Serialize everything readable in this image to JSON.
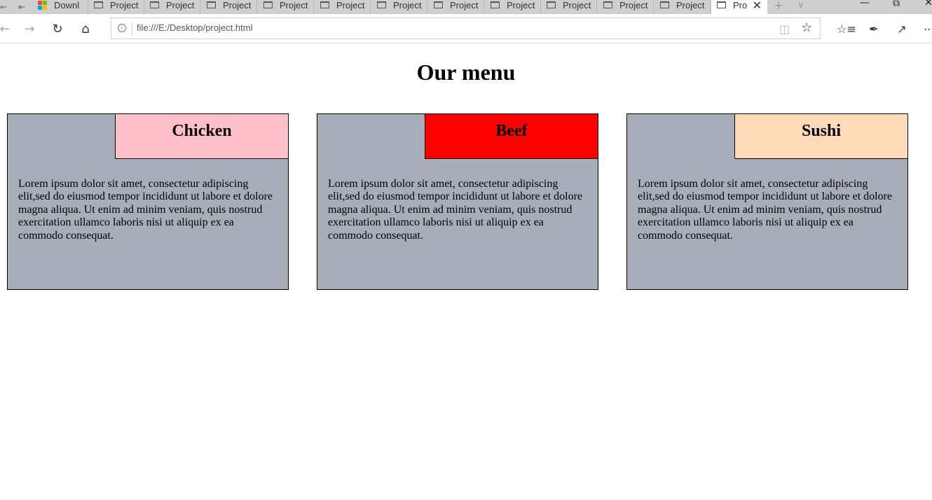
{
  "browser": {
    "tabs": [
      {
        "label": "Downl",
        "icon": "microsoft-icon"
      },
      {
        "label": "Project",
        "icon": "page-icon"
      },
      {
        "label": "Project",
        "icon": "page-icon"
      },
      {
        "label": "Project",
        "icon": "page-icon"
      },
      {
        "label": "Project",
        "icon": "page-icon"
      },
      {
        "label": "Project",
        "icon": "page-icon"
      },
      {
        "label": "Project",
        "icon": "page-icon"
      },
      {
        "label": "Project",
        "icon": "page-icon"
      },
      {
        "label": "Project",
        "icon": "page-icon"
      },
      {
        "label": "Project",
        "icon": "page-icon"
      },
      {
        "label": "Project",
        "icon": "page-icon"
      },
      {
        "label": "Project",
        "icon": "page-icon"
      },
      {
        "label": "Pro",
        "icon": "page-icon",
        "active": true
      }
    ],
    "address": {
      "url": "file:///E:/Desktop/project.html"
    },
    "icons": {
      "back": "back-arrow-icon",
      "forward": "forward-arrow-icon",
      "refresh": "refresh-icon",
      "home": "home-icon",
      "info": "info-icon",
      "reading_view": "reading-view-icon",
      "favorite": "star-icon",
      "favorites_hub": "favorites-list-icon",
      "notes": "pen-icon",
      "share": "share-icon",
      "more": "more-icon"
    }
  },
  "page": {
    "title": "Our menu",
    "cards": [
      {
        "name": "Chicken",
        "header_color": "#ffc0cb",
        "description": "Lorem ipsum dolor sit amet, consectetur adipiscing elit,sed do eiusmod tempor incididunt ut labore et dolore magna aliqua. Ut enim ad minim veniam, quis nostrud exercitation ullamco laboris nisi ut aliquip ex ea commodo consequat."
      },
      {
        "name": "Beef",
        "header_color": "#ff0000",
        "description": "Lorem ipsum dolor sit amet, consectetur adipiscing elit,sed do eiusmod tempor incididunt ut labore et dolore magna aliqua. Ut enim ad minim veniam, quis nostrud exercitation ullamco laboris nisi ut aliquip ex ea commodo consequat."
      },
      {
        "name": "Sushi",
        "header_color": "#ffdab9",
        "description": "Lorem ipsum dolor sit amet, consectetur adipiscing elit,sed do eiusmod tempor incididunt ut labore et dolore magna aliqua. Ut enim ad minim veniam, quis nostrud exercitation ullamco laboris nisi ut aliquip ex ea commodo consequat."
      }
    ],
    "card_body_color": "#a8adba"
  }
}
